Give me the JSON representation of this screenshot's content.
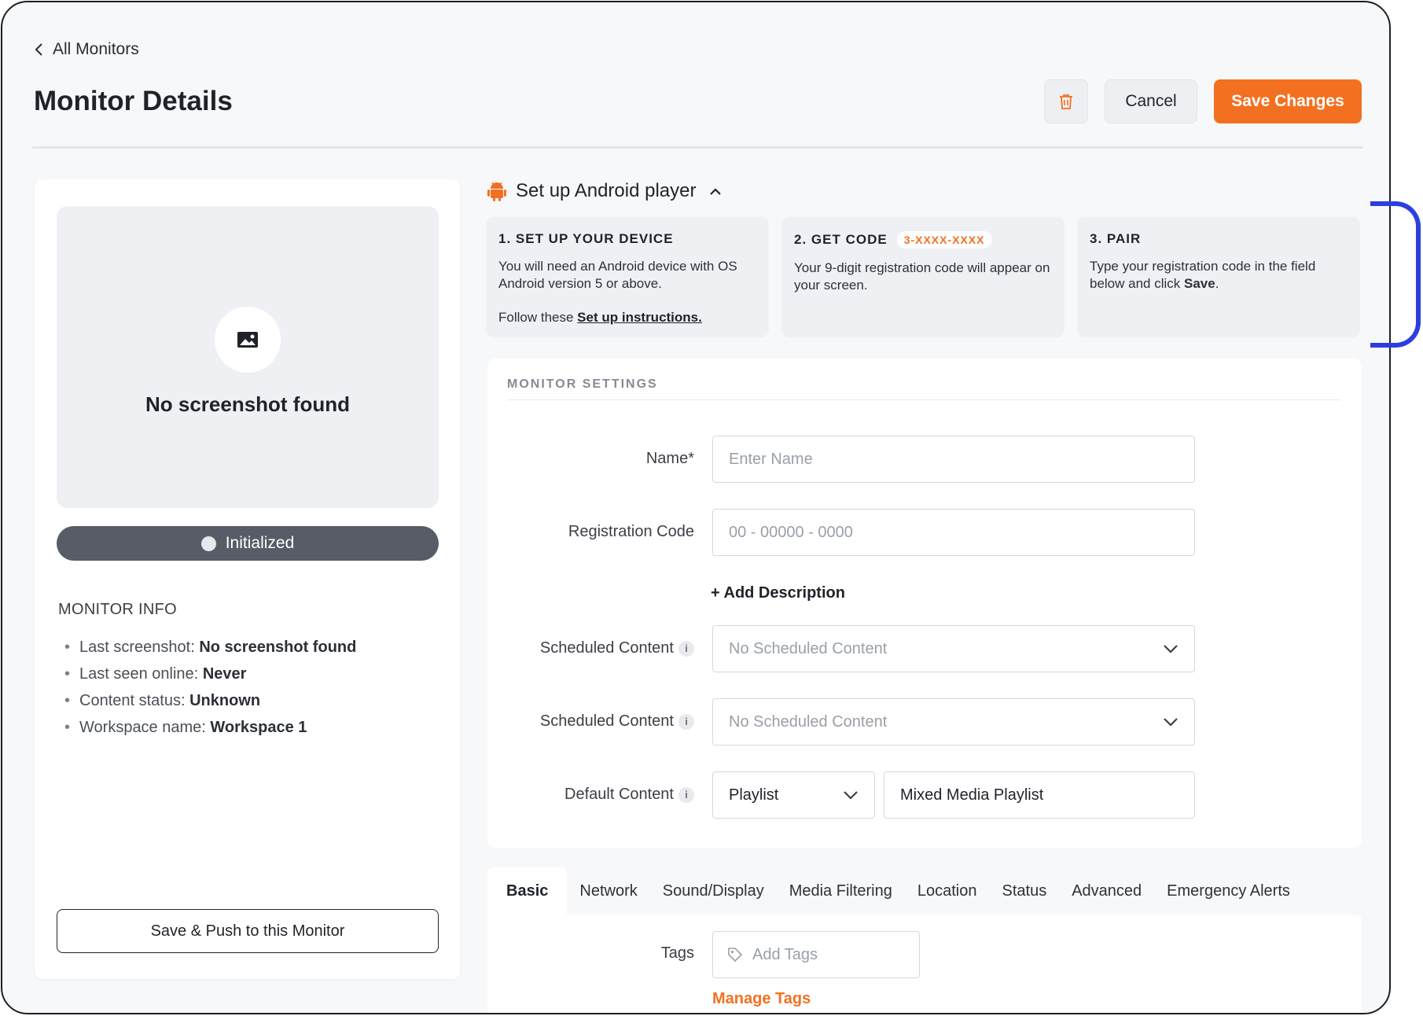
{
  "nav": {
    "back_label": "All Monitors"
  },
  "page": {
    "title": "Monitor Details"
  },
  "actions": {
    "cancel_label": "Cancel",
    "save_label": "Save Changes",
    "delete_icon": "trash-icon"
  },
  "preview": {
    "empty_text": "No screenshot found",
    "status_label": "Initialized"
  },
  "monitor_info": {
    "heading": "MONITOR INFO",
    "items": [
      {
        "label": "Last screenshot:",
        "value": "No screenshot found"
      },
      {
        "label": "Last seen online:",
        "value": "Never"
      },
      {
        "label": "Content status:",
        "value": "Unknown"
      },
      {
        "label": "Workspace name:",
        "value": "Workspace 1"
      }
    ],
    "push_button": "Save & Push to this Monitor"
  },
  "setup": {
    "title": "Set up Android player",
    "steps": [
      {
        "title": "1. SET UP YOUR DEVICE",
        "text": "You will need an Android device with OS Android version 5 or above.",
        "follow_prefix": "Follow these ",
        "follow_link": "Set up instructions."
      },
      {
        "title": "2. GET CODE",
        "badge": "3-XXXX-XXXX",
        "text": "Your 9-digit registration code will appear on your screen."
      },
      {
        "title": "3. PAIR",
        "text_prefix": "Type your registration code in the field below and click ",
        "text_bold": "Save",
        "text_suffix": "."
      }
    ]
  },
  "settings": {
    "heading": "MONITOR SETTINGS",
    "name": {
      "label": "Name*",
      "placeholder": "Enter Name",
      "value": ""
    },
    "registration": {
      "label": "Registration Code",
      "placeholder": "00 - 00000 - 0000",
      "value": ""
    },
    "add_description": "+ Add Description",
    "scheduled_1": {
      "label": "Scheduled Content",
      "placeholder": "No Scheduled Content"
    },
    "scheduled_2": {
      "label": "Scheduled Content",
      "placeholder": "No Scheduled Content"
    },
    "default": {
      "label": "Default Content",
      "type_value": "Playlist",
      "content_value": "Mixed Media Playlist"
    },
    "info_glyph": "i"
  },
  "tabs": [
    "Basic",
    "Network",
    "Sound/Display",
    "Media Filtering",
    "Location",
    "Status",
    "Advanced",
    "Emergency Alerts"
  ],
  "basic_tab": {
    "tags_label": "Tags",
    "tags_placeholder": "Add Tags",
    "manage_tags": "Manage Tags"
  },
  "colors": {
    "accent": "#f37021",
    "pill": "#575c66",
    "bracket": "#2b3fe0"
  }
}
